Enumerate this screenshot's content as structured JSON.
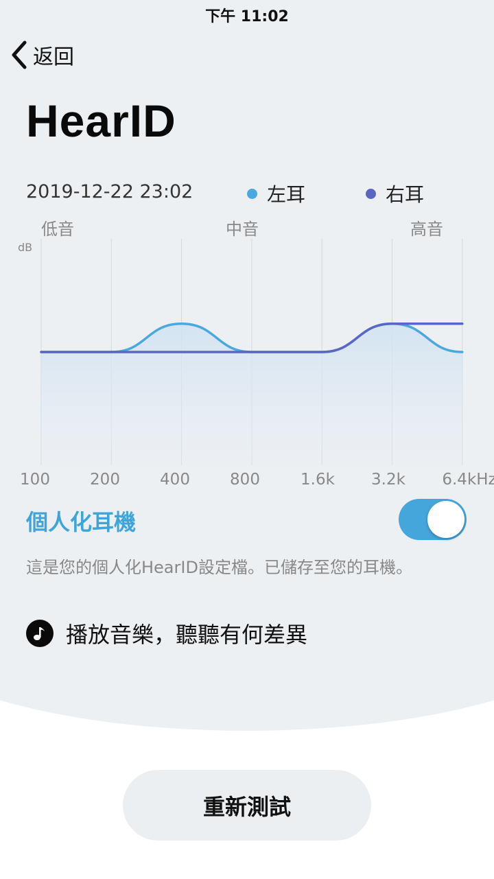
{
  "status_bar": {
    "time": "下午 11:02"
  },
  "header": {
    "back_label": "返回",
    "title": "HearID"
  },
  "profile": {
    "date": "2019-12-22 23:02"
  },
  "legend": {
    "left": {
      "label": "左耳",
      "color": "#4aa8de"
    },
    "right": {
      "label": "右耳",
      "color": "#5a67c2"
    }
  },
  "bands": {
    "low": "低音",
    "mid": "中音",
    "high": "高音"
  },
  "chart_data": {
    "type": "line",
    "ylabel": "dB",
    "categories": [
      "100",
      "200",
      "400",
      "800",
      "1.6k",
      "3.2k",
      "6.4kHz"
    ],
    "series": [
      {
        "name": "左耳",
        "color": "#4aa8de",
        "values": [
          0,
          0,
          1,
          0,
          0,
          1,
          0
        ]
      },
      {
        "name": "右耳",
        "color": "#5a67c2",
        "values": [
          0,
          0,
          0,
          0,
          0,
          1,
          1
        ]
      }
    ],
    "ylim": [
      -4,
      4
    ],
    "grid": true
  },
  "personalize": {
    "title": "個人化耳機",
    "enabled": true,
    "description": "這是您的個人化HearID設定檔。已儲存至您的耳機。"
  },
  "play": {
    "label": "播放音樂，聽聽有何差異",
    "icon": "music-note-icon"
  },
  "retest": {
    "label": "重新測試"
  }
}
